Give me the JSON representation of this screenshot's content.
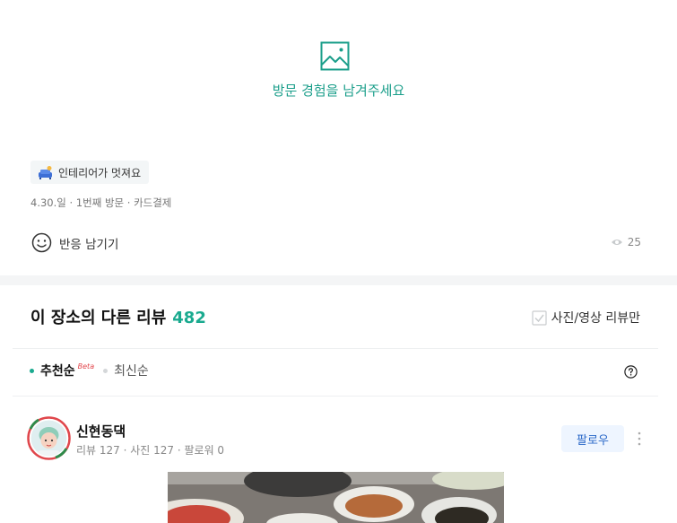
{
  "upload": {
    "icon": "image-icon",
    "prompt": "방문 경험을 남겨주세요",
    "accent_color": "#1a9e8a"
  },
  "review": {
    "tag": {
      "icon": "sofa-emoji-icon",
      "label": "인테리어가 멋져요"
    },
    "meta": "4.30.일 · 1번째 방문 · 카드결제",
    "reaction_label": "반응 남기기",
    "view_count": "25"
  },
  "other_reviews": {
    "title": "이 장소의 다른 리뷰",
    "count": "482",
    "count_color": "#1aaa8f",
    "filter_label": "사진/영상 리뷰만",
    "filter_checked": false,
    "sort": {
      "recommended": "추천순",
      "beta": "Beta",
      "latest": "최신순",
      "selected": "추천순"
    }
  },
  "reviewer": {
    "name": "신현동댁",
    "stats": "리뷰 127 · 사진 127 · 팔로워 0",
    "follow_label": "팔로우"
  }
}
